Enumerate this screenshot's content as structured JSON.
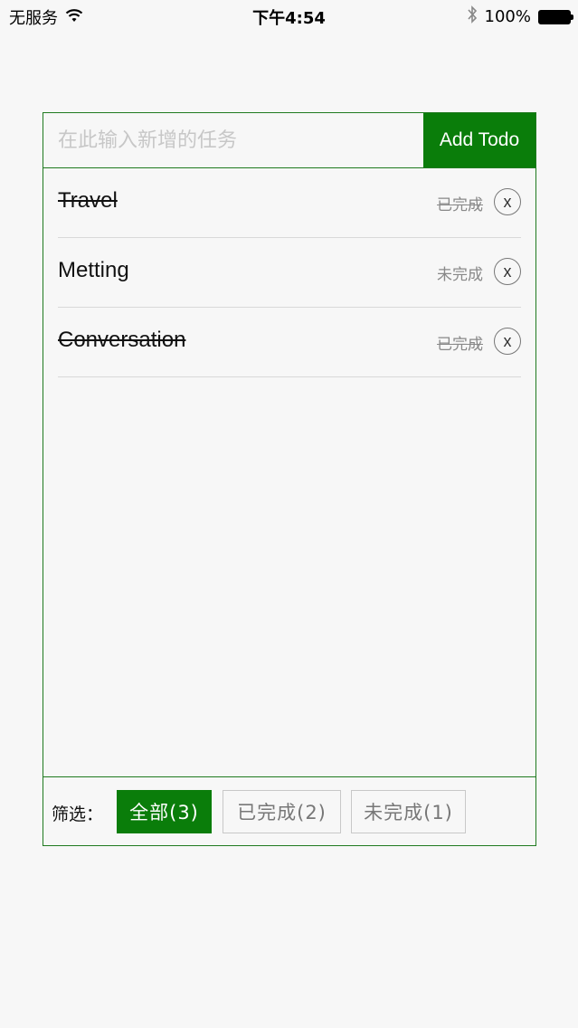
{
  "status_bar": {
    "carrier": "无服务",
    "time": "下午4:54",
    "battery": "100%",
    "icons": [
      "wifi-icon",
      "bluetooth-icon",
      "battery-icon"
    ]
  },
  "input": {
    "placeholder": "在此输入新增的任务",
    "value": ""
  },
  "add_button": "Add Todo",
  "todos": [
    {
      "text": "Travel",
      "status": "已完成",
      "done": true,
      "delete": "x"
    },
    {
      "text": "Metting",
      "status": "未完成",
      "done": false,
      "delete": "x"
    },
    {
      "text": "Conversation",
      "status": "已完成",
      "done": true,
      "delete": "x"
    }
  ],
  "filter": {
    "label": "筛选：",
    "buttons": [
      {
        "label": "全部(3)",
        "active": true
      },
      {
        "label": "已完成(2)",
        "active": false
      },
      {
        "label": "未完成(1)",
        "active": false
      }
    ]
  },
  "colors": {
    "accent": "#0a7d0a",
    "border": "#1f7a1f",
    "background": "#f7f7f7"
  }
}
